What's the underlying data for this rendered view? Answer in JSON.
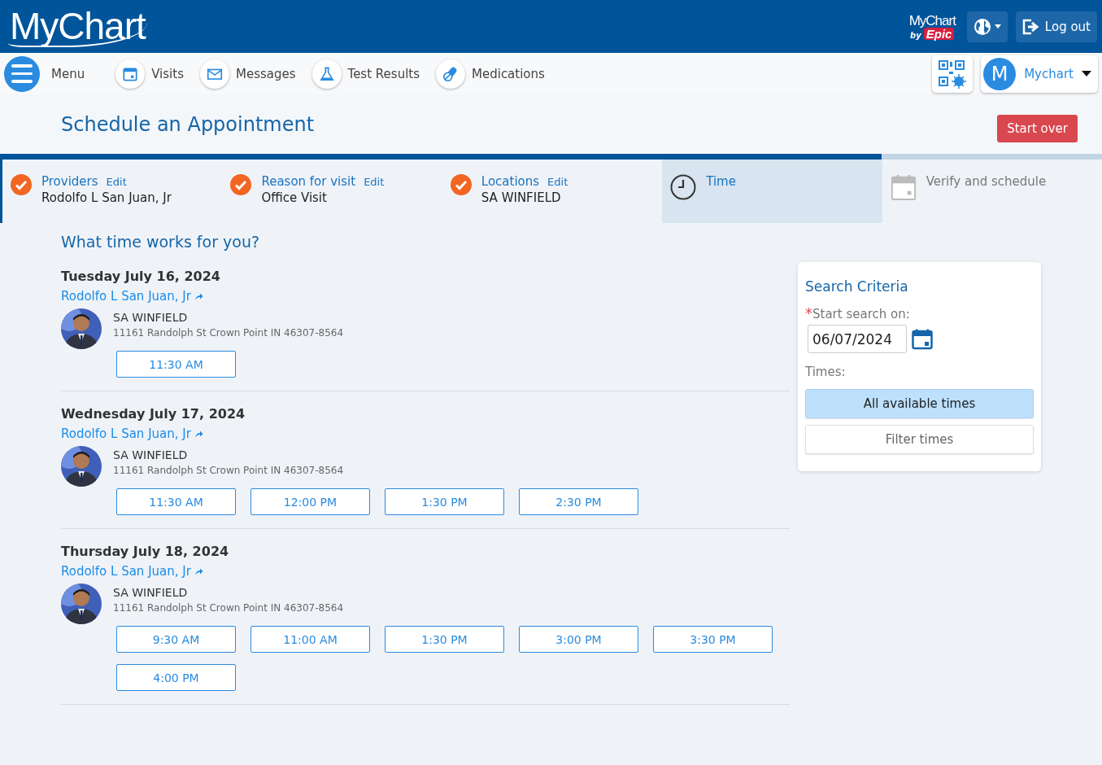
{
  "header": {
    "logo": "MyChart",
    "brand": {
      "top": "MyChart",
      "by": "by",
      "name": "Epic"
    },
    "logout": "Log out"
  },
  "nav": {
    "menu": "Menu",
    "items": [
      {
        "label": "Visits",
        "kind": "calendar"
      },
      {
        "label": "Messages",
        "kind": "envelope"
      },
      {
        "label": "Test Results",
        "kind": "flask"
      },
      {
        "label": "Medications",
        "kind": "pills"
      }
    ],
    "user": {
      "initial": "M",
      "name": "Mychart"
    }
  },
  "page": {
    "title": "Schedule an Appointment",
    "start_over": "Start over"
  },
  "progress": {
    "level": 0.8
  },
  "steps": [
    {
      "label": "Providers",
      "edit": "Edit",
      "value": "Rodolfo L San Juan, Jr",
      "kind": "done"
    },
    {
      "label": "Reason for visit",
      "edit": "Edit",
      "value": "Office Visit",
      "kind": "done"
    },
    {
      "label": "Locations",
      "edit": "Edit",
      "value": "SA WINFIELD",
      "kind": "done"
    },
    {
      "label": "Time",
      "kind": "current"
    },
    {
      "label": "Verify and schedule",
      "kind": "future"
    }
  ],
  "question": "What time works for you?",
  "days": [
    {
      "date": "Tuesday July 16, 2024",
      "provider": "Rodolfo L San Juan, Jr",
      "location": "SA WINFIELD",
      "address": "11161 Randolph St Crown Point IN 46307-8564",
      "times": [
        "11:30 AM"
      ]
    },
    {
      "date": "Wednesday July 17, 2024",
      "provider": "Rodolfo L San Juan, Jr",
      "location": "SA WINFIELD",
      "address": "11161 Randolph St Crown Point IN 46307-8564",
      "times": [
        "11:30 AM",
        "12:00 PM",
        "1:30 PM",
        "2:30 PM"
      ]
    },
    {
      "date": "Thursday July 18, 2024",
      "provider": "Rodolfo L San Juan, Jr",
      "location": "SA WINFIELD",
      "address": "11161 Randolph St Crown Point IN 46307-8564",
      "times": [
        "9:30 AM",
        "11:00 AM",
        "1:30 PM",
        "3:00 PM",
        "3:30 PM",
        "4:00 PM"
      ]
    }
  ],
  "search": {
    "title": "Search Criteria",
    "required": "*",
    "start_label": "Start search on:",
    "start_value": "06/07/2024",
    "times_label": "Times:",
    "options": [
      {
        "label": "All available times",
        "selected": true
      },
      {
        "label": "Filter times",
        "selected": false
      }
    ]
  }
}
